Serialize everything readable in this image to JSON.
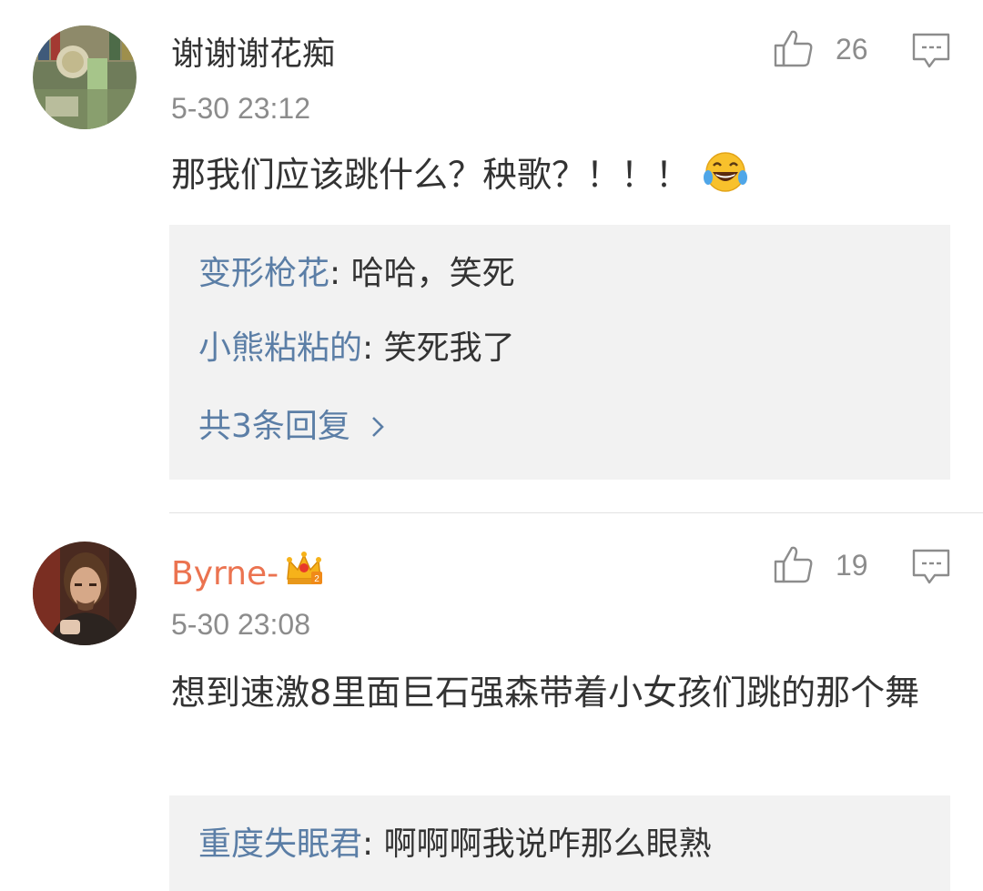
{
  "comments": [
    {
      "username": "谢谢谢花痴",
      "timestamp": "5-30 23:12",
      "content": "那我们应该跳什么？秧歌？！！！",
      "emoji": "laughing-tears-emoji",
      "likes": "26",
      "replies": [
        {
          "name": "变形枪花",
          "separator": ": ",
          "text": "哈哈，笑死"
        },
        {
          "name": "小熊粘粘的",
          "separator": ": ",
          "text": "笑死我了"
        }
      ],
      "more_replies": "共3条回复"
    },
    {
      "username": "Byrne-",
      "badge": "crown-vip-badge",
      "timestamp": "5-30 23:08",
      "content": "想到速激8里面巨石强森带着小女孩们跳的那个舞",
      "likes": "19",
      "replies": [
        {
          "name": "重度失眠君",
          "separator": ": ",
          "text": "啊啊啊我说咋那么眼熟"
        }
      ]
    }
  ],
  "colors": {
    "link": "#5b7ea6",
    "vip_name": "#eb7350",
    "meta": "#8c8c8c",
    "reply_bg": "#f2f2f2"
  }
}
